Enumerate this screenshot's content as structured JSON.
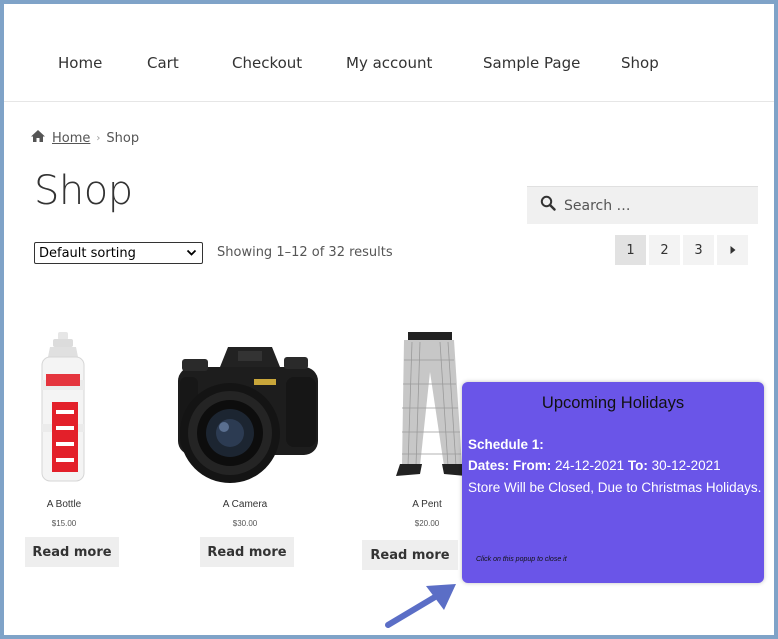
{
  "nav": {
    "items": [
      {
        "label": "Home"
      },
      {
        "label": "Cart"
      },
      {
        "label": "Checkout"
      },
      {
        "label": "My account"
      },
      {
        "label": "Sample Page"
      },
      {
        "label": "Shop"
      }
    ]
  },
  "breadcrumb": {
    "home": "Home",
    "current": "Shop"
  },
  "page": {
    "title": "Shop"
  },
  "search": {
    "placeholder": "Search …"
  },
  "sorting": {
    "selected": "Default sorting"
  },
  "results": {
    "text": "Showing 1–12 of 32 results"
  },
  "pagination": {
    "pages": [
      "1",
      "2",
      "3"
    ],
    "current": "1"
  },
  "products": [
    {
      "name": "A Bottle",
      "price": "$15.00",
      "button": "Read more"
    },
    {
      "name": "A Camera",
      "price": "$30.00",
      "button": "Read more"
    },
    {
      "name": "A Pent",
      "price": "$20.00",
      "button": "Read more"
    }
  ],
  "popup": {
    "title": "Upcoming Holidays",
    "schedule_label": "Schedule 1:",
    "dates_label": "Dates: From:",
    "from": "24-12-2021",
    "to_label": "To:",
    "to": "30-12-2021",
    "message": "Store Will be Closed, Due to Christmas Holidays.",
    "hint": "Click on this popup to close it"
  },
  "colors": {
    "popup_bg": "#6a55e8",
    "arrow": "#5b6ec6",
    "frame": "#7fa3c8"
  }
}
